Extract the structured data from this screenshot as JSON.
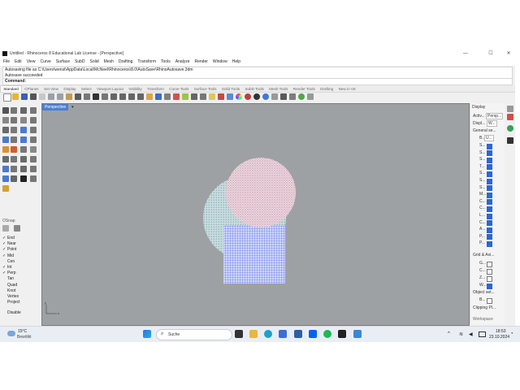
{
  "window": {
    "title": "Untitled - Rhinoceros 8 Educational Lab License - [Perspective]",
    "controls": {
      "minimize": "—",
      "maximize": "☐",
      "close": "✕"
    }
  },
  "menu": [
    "File",
    "Edit",
    "View",
    "Curve",
    "Surface",
    "SubD",
    "Solid",
    "Mesh",
    "Drafting",
    "Transform",
    "Tools",
    "Analyze",
    "Render",
    "Window",
    "Help"
  ],
  "command_history": [
    "Autosaving file as C:\\Users\\wenst\\AppData\\Local\\McNeel\\Rhinoceros\\8.0\\AutoSave\\RhinoAutosave.3dm",
    "Autosave succeeded"
  ],
  "command_label": "Command:",
  "toolbar_tabs": [
    "Standard",
    "CPlanes",
    "Set View",
    "Display",
    "Select",
    "Viewport Layout",
    "Visibility",
    "Transform",
    "Curve Tools",
    "Surface Tools",
    "Solid Tools",
    "SubD Tools",
    "Mesh Tools",
    "Render Tools",
    "Drafting",
    "New in V8"
  ],
  "active_tab": "Standard",
  "viewport": {
    "label": "Perspective",
    "menu_arrow": "▾",
    "axis_x": "x",
    "axis_y": "y"
  },
  "osnap": {
    "title": "OSnap",
    "items": [
      {
        "label": "End",
        "checked": true
      },
      {
        "label": "Near",
        "checked": true
      },
      {
        "label": "Point",
        "checked": true
      },
      {
        "label": "Mid",
        "checked": true
      },
      {
        "label": "Cen",
        "checked": false
      },
      {
        "label": "Int",
        "checked": true
      },
      {
        "label": "Perp",
        "checked": true
      },
      {
        "label": "Tan",
        "checked": false
      },
      {
        "label": "Quad",
        "checked": false
      },
      {
        "label": "Knot",
        "checked": false
      },
      {
        "label": "Vertex",
        "checked": false
      },
      {
        "label": "Project",
        "checked": false
      },
      {
        "label": "Disable",
        "checked": false
      }
    ]
  },
  "display_panel": {
    "title": "Display",
    "active_label": "Activ...",
    "active_value": "Persp...",
    "display_label": "Displ...",
    "display_value": "W...",
    "general_header": "General se...",
    "bg_label": "B...",
    "bg_value": "U...",
    "general_rows": [
      "S...",
      "S...",
      "S...",
      "T...",
      "S...",
      "S...",
      "S...",
      "M...",
      "C...",
      "C...",
      "L...",
      "C...",
      "A...",
      "P...",
      "P..."
    ],
    "grid_header": "Grid & Axi...",
    "grid_rows": [
      {
        "label": "G...",
        "checked": false
      },
      {
        "label": "C...",
        "checked": false
      },
      {
        "label": "Z...",
        "checked": false
      },
      {
        "label": "W...",
        "checked": true
      }
    ],
    "object_header": "Object set...",
    "object_rows": [
      {
        "label": "B...",
        "checked": false
      }
    ],
    "clipping_header": "Clipping Pl...",
    "bottom_text": "Workspace"
  },
  "taskbar": {
    "weather_temp": "15°C",
    "weather_desc": "Bewölkt",
    "search_placeholder": "Suche",
    "time": "18:53",
    "date": "23.10.2024"
  },
  "colors": {
    "viewport_bg": "#9ea1a4",
    "active_blue": "#4d7fd0",
    "sphere_pink": "#e8cfd8",
    "sphere_teal": "#b9d2d6",
    "mesh_blue": "#7f8ff0"
  }
}
